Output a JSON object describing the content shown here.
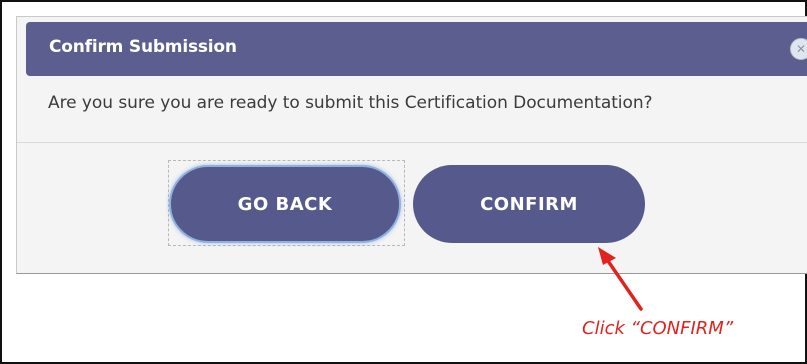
{
  "dialog": {
    "title": "Confirm Submission",
    "close_icon": "close-icon",
    "message": "Are you sure you are ready to submit this Certification Documentation?"
  },
  "buttons": {
    "go_back": "GO BACK",
    "confirm": "CONFIRM"
  },
  "annotation": {
    "text": "Click “CONFIRM”"
  },
  "colors": {
    "title_bar": "#5b5e8e",
    "button": "#55598b",
    "annotation": "#e0231f"
  }
}
